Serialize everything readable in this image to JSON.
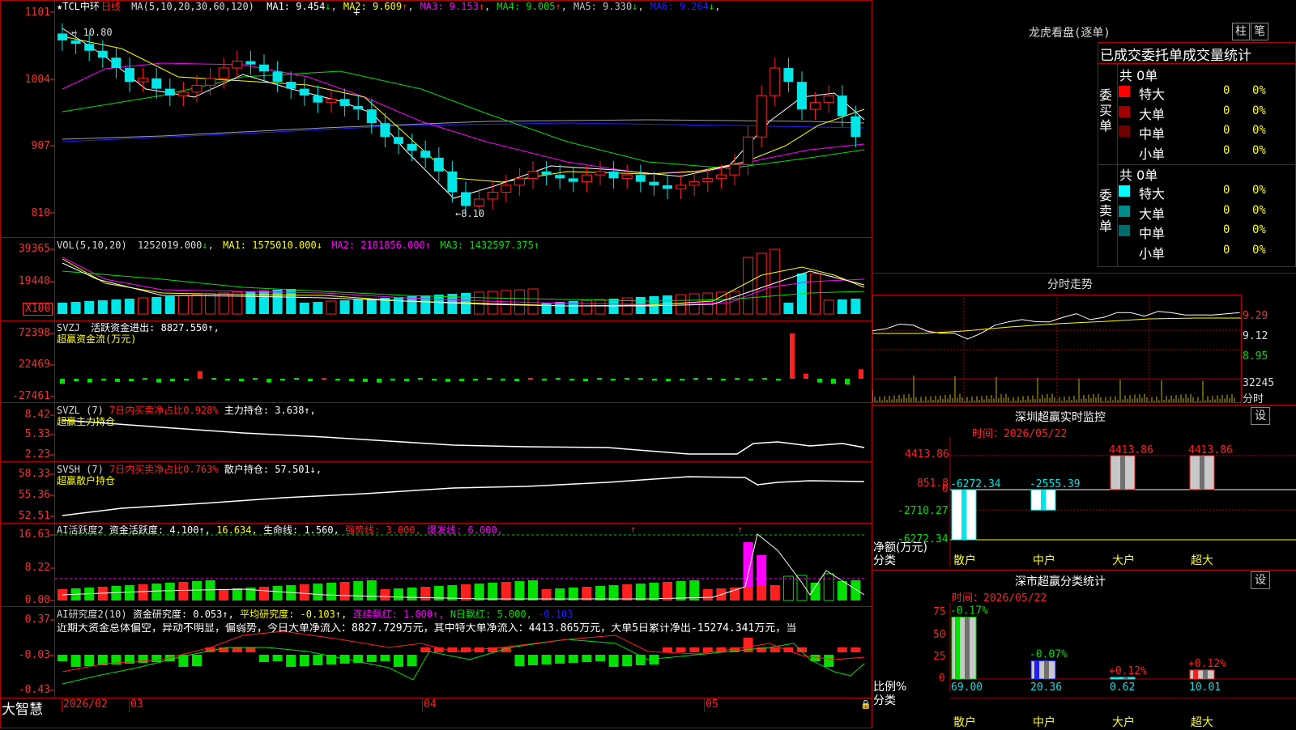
{
  "colors": {
    "up": "#ff2020",
    "down": "#00e5e5",
    "ma1": "#ffffff",
    "ma2": "#ffff00",
    "ma3": "#ff00ff",
    "ma4": "#00e000",
    "ma5": "#a0a0a0",
    "ma6": "#2020ff"
  },
  "main": {
    "title_star": "★",
    "symbol": "TCL中环",
    "period": "日线",
    "ma_prefix": "MA(5,10,20,30,60,120)",
    "ma_items": [
      {
        "label": "MA1:",
        "value": "9.454",
        "arrow": "↓",
        "color": "#ffffff"
      },
      {
        "label": "MA2:",
        "value": "9.609",
        "arrow": "↑",
        "color": "#ffff00"
      },
      {
        "label": "MA3:",
        "value": "9.153",
        "arrow": "↑",
        "color": "#ff00ff"
      },
      {
        "label": "MA4:",
        "value": "9.005",
        "arrow": "↑",
        "color": "#00e000"
      },
      {
        "label": "MA5:",
        "value": "9.330",
        "arrow": "↓",
        "color": "#c0c0c0"
      },
      {
        "label": "MA6:",
        "value": "9.264",
        "arrow": "↓",
        "color": "#2020ff"
      }
    ],
    "y_ticks": [
      "1101",
      "1004",
      "907",
      "810"
    ],
    "high_label": "10.80",
    "low_label": "8.10"
  },
  "vol": {
    "prefix": "VOL(5,10,20)",
    "value": "1252019.000",
    "arrow": "↓",
    "ma1": "MA1: 1575010.000↓",
    "ma2": "MA2: 2181856.000↑",
    "ma3": "MA3: 1432597.375↑",
    "y_ticks": [
      "39365",
      "19440"
    ],
    "unit": "X100"
  },
  "svzj": {
    "name": "SVZJ",
    "label": "活跃资金进出: 8827.550↑,",
    "sub": "超赢资金流(万元)",
    "y_ticks": [
      "72398",
      "22469",
      "-27461"
    ]
  },
  "svzl": {
    "name": "SVZL (7)",
    "ratio": "7日内买卖净占比0.928%",
    "hold": "主力持仓: 3.638↑,",
    "sub": "超赢主力持仓",
    "y_ticks": [
      "8.42",
      "5.33",
      "2.23"
    ]
  },
  "svsh": {
    "name": "SVSH (7)",
    "ratio": "7日内买卖净占比0.763%",
    "hold": "散户持仓: 57.501↓,",
    "sub": "超赢散户持仓",
    "y_ticks": [
      "58.33",
      "55.36",
      "52.51"
    ]
  },
  "ai1": {
    "name": "AI活跃度2",
    "act": "资金活跃度: 4.100↑,",
    "v2": "16.634,",
    "life": "生命线: 1.560,",
    "strong": "强势线: 3.000,",
    "burst": "爆发线: 6.000,",
    "y_ticks": [
      "16.63",
      "8.22",
      "0.00"
    ]
  },
  "ai2": {
    "name": "AI研究度2(10)",
    "res": "资金研究度: 0.053↑,",
    "avg": "平均研究度: -0.103↑,",
    "cont": "连续飘红: 1.000↑,",
    "nday": "N日飘红: 5.000,",
    "neg": "-0.103",
    "desc": "近期大资金总体偏空，异动不明显，偏弱势，今日大单净流入：8827.729万元，其中特大单净流入：4413.865万元，大单5日累计净出-15274.341万元，当",
    "y_ticks": [
      "0.37",
      "-0.03",
      "-0.43"
    ]
  },
  "xaxis": {
    "logo": "大智慧",
    "dates": [
      "2026/02",
      "03",
      "04",
      "05"
    ]
  },
  "right": {
    "lhb_title": "龙虎看盘(逐单)",
    "btn1": "柱",
    "btn2": "笔",
    "stat_title": "已成交委托单成交量统计",
    "buy": {
      "side": "委买单",
      "total": "共 0单",
      "rows": [
        {
          "name": "特大",
          "v": "0",
          "p": "0%",
          "c": "#ff0000"
        },
        {
          "name": "大单",
          "v": "0",
          "p": "0%",
          "c": "#a00000"
        },
        {
          "name": "中单",
          "v": "0",
          "p": "0%",
          "c": "#700000"
        },
        {
          "name": "小单",
          "v": "0",
          "p": "0%",
          "c": "#000000"
        }
      ]
    },
    "sell": {
      "side": "委卖单",
      "total": "共 0单",
      "rows": [
        {
          "name": "特大",
          "v": "0",
          "p": "0%",
          "c": "#00ffff"
        },
        {
          "name": "大单",
          "v": "0",
          "p": "0%",
          "c": "#008b8b"
        },
        {
          "name": "中单",
          "v": "0",
          "p": "0%",
          "c": "#006b6b"
        },
        {
          "name": "小单",
          "v": "0",
          "p": "0%",
          "c": "#000000"
        }
      ]
    },
    "fs_title": "分时走势",
    "fs_ticks": [
      "9.29",
      "9.12",
      "8.95"
    ],
    "fs_vol": "32245",
    "fs_unit": "分时",
    "mon_title": "深圳超赢实时监控",
    "set": "设",
    "time1": "时间：2026/05/22",
    "mon_ticks": [
      "4413.86",
      "851.8",
      "0",
      "-2710.27",
      "-6272.34"
    ],
    "mon_unit": "净额(万元)",
    "mon_cat": "分类",
    "mon_vals": [
      "-6272.34",
      "-2555.39",
      "4413.86",
      "4413.86"
    ],
    "cats": [
      "散户",
      "中户",
      "大户",
      "超大"
    ],
    "cls_title": "深市超赢分类统计",
    "time2": "时间：2026/05/22",
    "cls_ticks": [
      "75",
      "50",
      "25",
      "0"
    ],
    "cls_unit": "比例%",
    "cls_cat": "分类",
    "cls_top": [
      "-0.17%",
      "-0.07%",
      "+0.12%",
      "+0.12%"
    ],
    "cls_vals": [
      "69.00",
      "20.36",
      "0.62",
      "10.01"
    ]
  },
  "chart_data": {
    "type": "candlestick",
    "price_scale": {
      "ticks": [
        11.01,
        10.04,
        9.07,
        8.1
      ],
      "high": 10.8,
      "low": 8.1
    },
    "closes": [
      10.6,
      10.55,
      10.45,
      10.35,
      10.2,
      10.0,
      10.05,
      9.9,
      9.8,
      9.85,
      9.95,
      10.05,
      10.2,
      10.3,
      10.25,
      10.15,
      10.0,
      9.9,
      9.8,
      9.7,
      9.75,
      9.65,
      9.6,
      9.4,
      9.2,
      9.1,
      9.0,
      8.9,
      8.7,
      8.4,
      8.2,
      8.3,
      8.4,
      8.5,
      8.6,
      8.7,
      8.65,
      8.6,
      8.55,
      8.65,
      8.7,
      8.6,
      8.65,
      8.55,
      8.5,
      8.45,
      8.5,
      8.55,
      8.6,
      8.65,
      8.8,
      9.2,
      9.8,
      10.2,
      10.0,
      9.6,
      9.7,
      9.8,
      9.5,
      9.2
    ],
    "svzj": [
      -8,
      -4,
      -6,
      -3,
      -5,
      -4,
      -2,
      -6,
      -4,
      -3,
      12,
      -2,
      -3,
      -4,
      -2,
      -6,
      -3,
      -2,
      -4,
      2,
      -3,
      -4,
      -5,
      -6,
      -3,
      -4,
      -2,
      -3,
      -5,
      -4,
      -3,
      -2,
      -3,
      -4,
      2,
      -3,
      -2,
      -3,
      -4,
      -2,
      -3,
      -2,
      -2,
      -3,
      -4,
      -3,
      -2,
      -2,
      -3,
      -2,
      -3,
      -2,
      -3,
      72,
      8,
      -6,
      -8,
      -9,
      15,
      -10,
      5
    ],
    "fs_price": [
      9.1,
      9.14,
      9.18,
      9.15,
      9.12,
      9.1,
      9.08,
      9.05,
      9.1,
      9.15,
      9.2,
      9.22,
      9.18,
      9.2,
      9.24,
      9.25,
      9.22,
      9.24,
      9.26,
      9.28,
      9.25,
      9.27,
      9.28,
      9.26,
      9.24,
      9.26,
      9.27,
      9.26
    ]
  }
}
